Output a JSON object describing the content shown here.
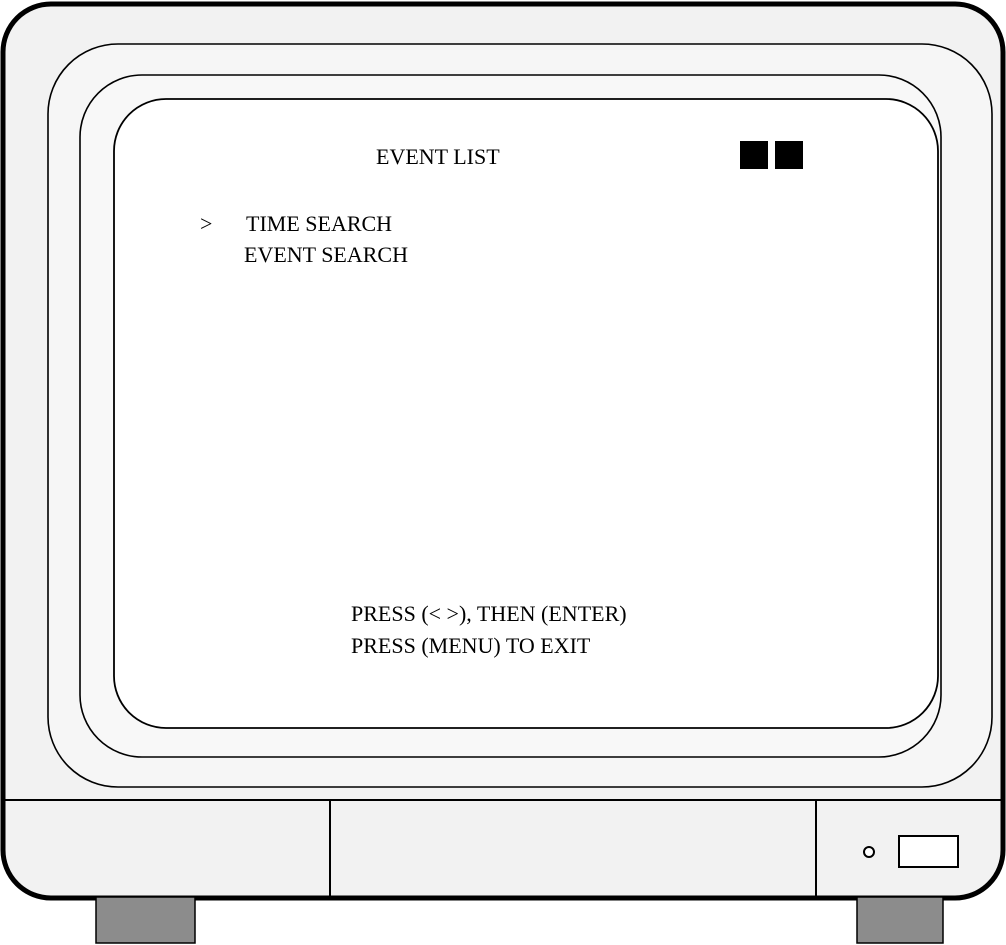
{
  "screen": {
    "title": "EVENT LIST",
    "cursor": ">",
    "menu_items": [
      {
        "label": "TIME SEARCH",
        "selected": true
      },
      {
        "label": "EVENT SEARCH",
        "selected": false
      }
    ],
    "instructions": [
      "PRESS (< >), THEN (ENTER)",
      "PRESS (MENU) TO EXIT"
    ],
    "indicator_blocks": 2
  },
  "colors": {
    "outline": "#000000",
    "bezel": "#f2f2f2",
    "screen": "#ffffff",
    "feet": "#8c8c8c"
  }
}
